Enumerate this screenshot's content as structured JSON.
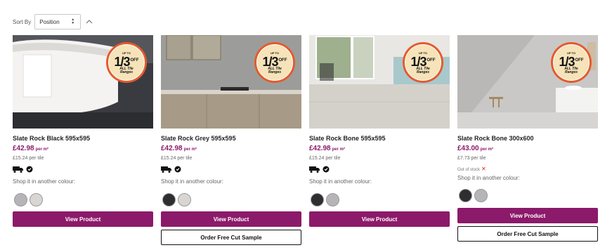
{
  "toolbar": {
    "sort_label": "Sort By",
    "sort_value": "Position"
  },
  "promo": {
    "up_to": "UP TO",
    "fraction": "1/3",
    "off": "OFF",
    "all": "ALL",
    "tile": "Tile",
    "ranges": "Ranges"
  },
  "colour_prompt": "Shop it in another colour:",
  "view_label": "View Product",
  "sample_label": "Order Free Cut Sample",
  "products": [
    {
      "name": "Slate Rock Black 595x595",
      "price": "£42.98",
      "price_unit": "per m²",
      "per_tile": "£15.24 per tile",
      "swatches": [
        "#b6b4b7",
        "#d9d5d2"
      ]
    },
    {
      "name": "Slate Rock Grey 595x595",
      "price": "£42.98",
      "price_unit": "per m²",
      "per_tile": "£15.24 per tile",
      "swatches": [
        "#2e2e30",
        "#d9d5d2"
      ]
    },
    {
      "name": "Slate Rock Bone 595x595",
      "price": "£42.98",
      "price_unit": "per m²",
      "per_tile": "£15.24 per tile",
      "swatches": [
        "#2e2e30",
        "#b6b4b7"
      ]
    },
    {
      "name": "Slate Rock Bone 300x600",
      "price": "£43.00",
      "price_unit": "per m²",
      "per_tile": "£7.73 per tile",
      "stock": "Out of stock",
      "swatches": [
        "#2e2e30",
        "#b6b4b7"
      ]
    }
  ],
  "colors": {
    "accent": "#8c1a6a",
    "badge_ring": "#e55a2b",
    "badge_fill": "#f6e3b9"
  }
}
